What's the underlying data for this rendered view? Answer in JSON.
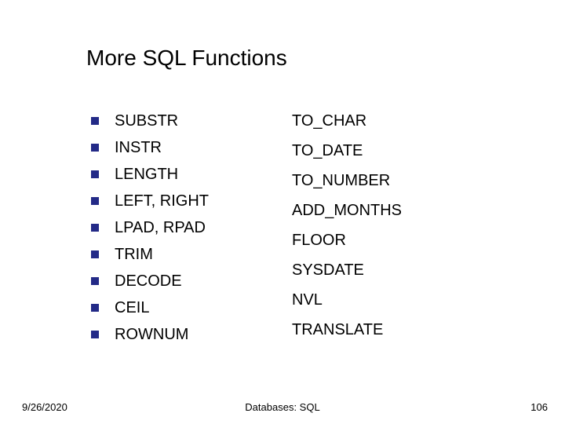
{
  "title": "More SQL Functions",
  "left_items": [
    "SUBSTR",
    "INSTR",
    "LENGTH",
    "LEFT, RIGHT",
    "LPAD, RPAD",
    "TRIM",
    "DECODE",
    "CEIL",
    "ROWNUM"
  ],
  "right_items": [
    "TO_CHAR",
    "TO_DATE",
    "TO_NUMBER",
    "ADD_MONTHS",
    "FLOOR",
    "SYSDATE",
    "NVL",
    "TRANSLATE"
  ],
  "footer": {
    "date": "9/26/2020",
    "center": "Databases: SQL",
    "page": "106"
  }
}
